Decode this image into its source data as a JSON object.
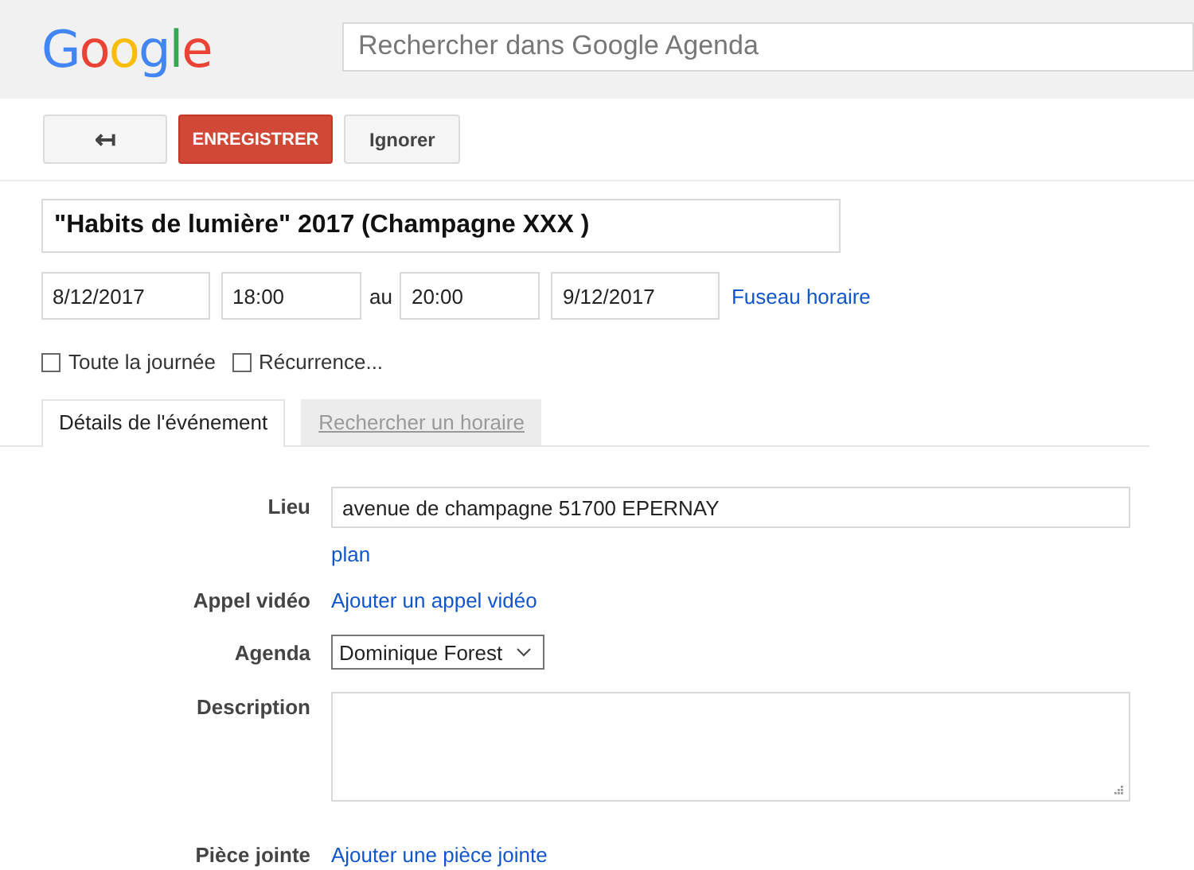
{
  "header": {
    "logo": "Google",
    "search": {
      "placeholder": "Rechercher dans Google Agenda"
    }
  },
  "toolbar": {
    "back_button": "↤",
    "save_button": "ENREGISTRER",
    "discard_button": "Ignorer"
  },
  "event": {
    "title": "\"Habits de lumière\" 2017 (Champagne XXX )",
    "start_date": "8/12/2017",
    "start_time": "18:00",
    "separator": "au",
    "end_time": "20:00",
    "end_date": "9/12/2017",
    "timezone_link": "Fuseau horaire"
  },
  "options": [
    {
      "label": "Toute la journée",
      "checked": false
    },
    {
      "label": "Récurrence...",
      "checked": false
    }
  ],
  "tabs": [
    {
      "label": "Détails de l'événement",
      "selected": true
    },
    {
      "label": "Rechercher un horaire",
      "selected": false
    }
  ],
  "details": [
    {
      "kind": "input",
      "label": "Lieu",
      "value": "avenue de champagne 51700 EPERNAY",
      "link": "plan"
    },
    {
      "kind": "link",
      "label": "Appel vidéo",
      "link": "Ajouter un appel vidéo"
    },
    {
      "kind": "select",
      "label": "Agenda",
      "value": "Dominique Forest"
    },
    {
      "kind": "textarea",
      "label": "Description"
    },
    {
      "kind": "link",
      "label": "Pièce jointe",
      "link": "Ajouter une pièce jointe"
    }
  ]
}
